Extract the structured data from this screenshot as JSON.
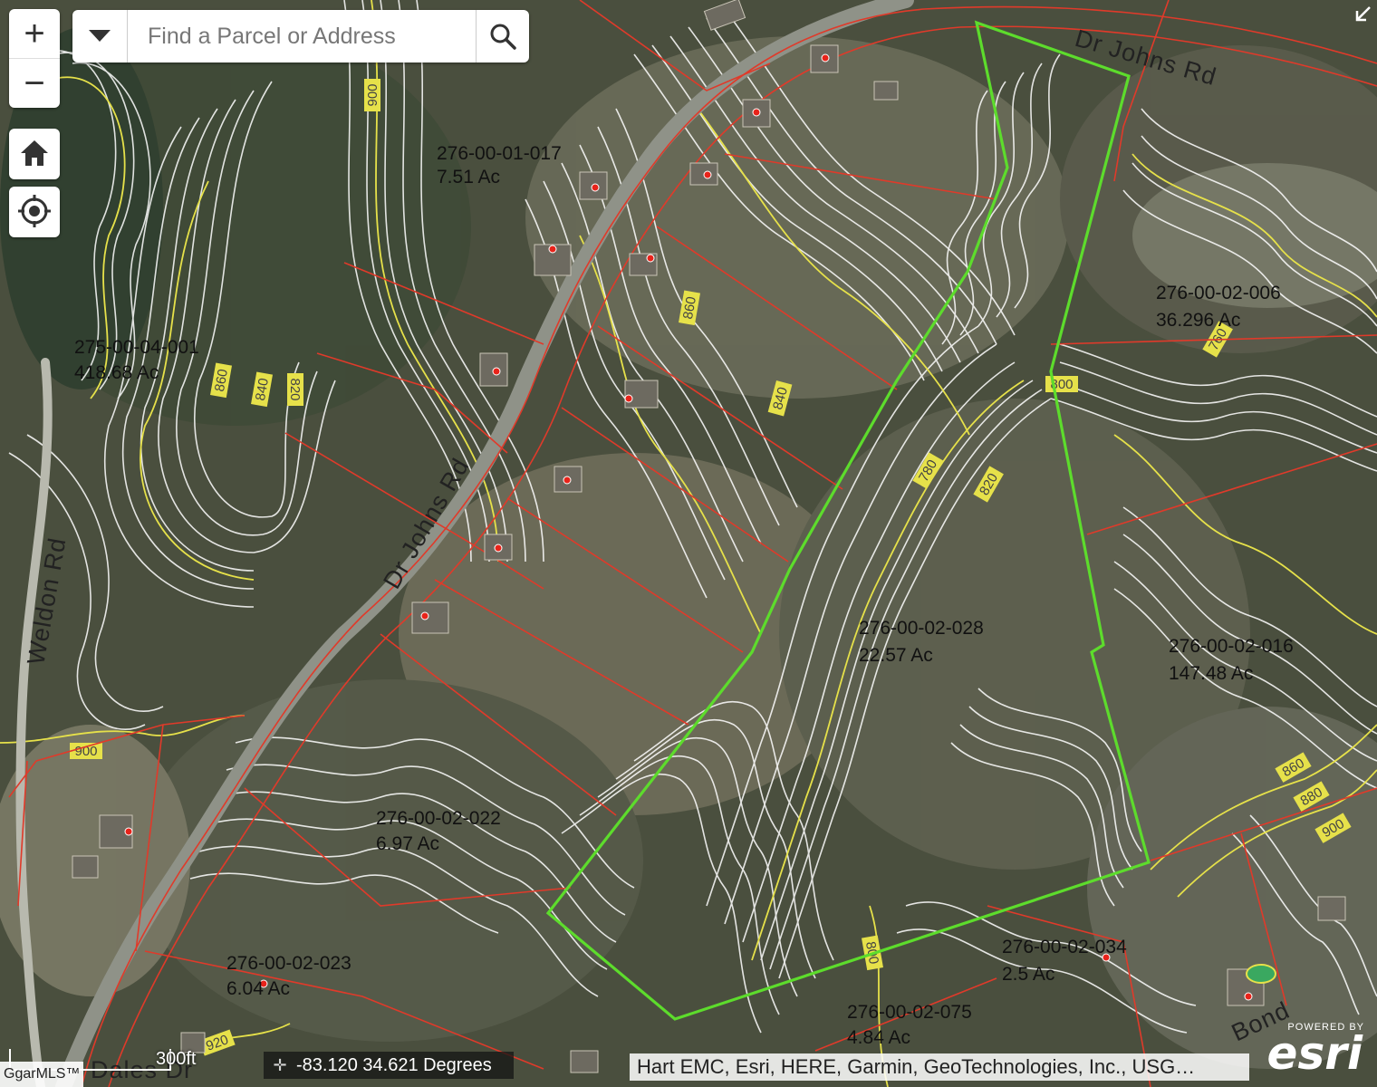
{
  "search": {
    "placeholder": "Find a Parcel or Address"
  },
  "controls": {
    "zoom_in": "+",
    "zoom_out": "−"
  },
  "scale": {
    "label": "300ft"
  },
  "coordinates": {
    "text": "-83.120 34.621 Degrees"
  },
  "attribution": "Hart EMC, Esri, HERE, Garmin, GeoTechnologies, Inc., USG…",
  "esri": {
    "powered_by": "POWERED BY",
    "logo": "esri"
  },
  "mls_logo": "GgarMLS™",
  "roads": [
    {
      "name": "Dr Johns Rd"
    },
    {
      "name": "Dr Johns Rd"
    },
    {
      "name": "Weldon Rd"
    },
    {
      "name": "Dales Dr"
    },
    {
      "name": "Bond"
    }
  ],
  "parcels": [
    {
      "id": "276-00-01-017",
      "acres": "7.51 Ac"
    },
    {
      "id": "275-00-04-001",
      "acres": "418.68 Ac"
    },
    {
      "id": "276-00-02-006",
      "acres": "36.296 Ac"
    },
    {
      "id": "276-00-02-028",
      "acres": "22.57 Ac"
    },
    {
      "id": "276-00-02-016",
      "acres": "147.48 Ac"
    },
    {
      "id": "276-00-02-022",
      "acres": "6.97 Ac"
    },
    {
      "id": "276-00-02-023",
      "acres": "6.04 Ac"
    },
    {
      "id": "276-00-02-034",
      "acres": "2.5 Ac"
    },
    {
      "id": "276-00-02-075",
      "acres": "4.84 Ac"
    }
  ],
  "contour_labels": [
    "900",
    "860",
    "840",
    "820",
    "860",
    "840",
    "780",
    "820",
    "800",
    "760",
    "900",
    "860",
    "880",
    "900",
    "800",
    "920"
  ],
  "colors": {
    "parcel_line": "#e03a2a",
    "subject_parcel": "#5ddc2c",
    "contour_major": "#e6e14a",
    "contour_minor": "#ffffff",
    "building_marker": "#e8231a"
  }
}
